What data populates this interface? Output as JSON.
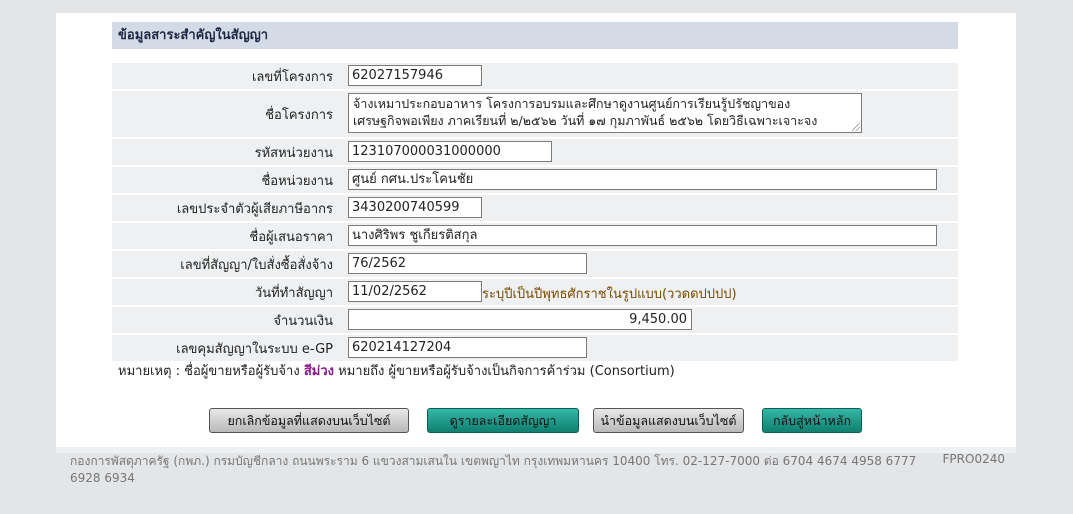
{
  "section_title": "ข้อมูลสาระสำคัญในสัญญา",
  "fields": {
    "project_no_label": "เลขที่โครงการ",
    "project_no": "62027157946",
    "project_name_label": "ชื่อโครงการ",
    "project_name_line1": "จ้างเหมาประกอบอาหาร โครงการอบรมและศึกษาดูงานศูนย์การเรียนรู้ปรัชญาของ",
    "project_name_line2": "เศรษฐกิจพอเพียง ภาคเรียนที่ ๒/๒๕๖๒ วันที่ ๑๗ กุมภาพันธ์ ๒๕๖๒ โดยวิธีเฉพาะเจาะจง",
    "agency_code_label": "รหัสหน่วยงาน",
    "agency_code": "123107000031000000",
    "agency_name_label": "ชื่อหน่วยงาน",
    "agency_name": "ศูนย์ กศน.ประโคนชัย",
    "tax_id_label": "เลขประจำตัวผู้เสียภาษีอากร",
    "tax_id": "3430200740599",
    "bidder_name_label": "ชื่อผู้เสนอราคา",
    "bidder_name": "นางศิริพร ชูเกียรติสกุล",
    "contract_no_label": "เลขที่สัญญา/ใบสั่งซื้อสั่งจ้าง",
    "contract_no": "76/2562",
    "contract_date_label": "วันที่ทำสัญญา",
    "contract_date": "11/02/2562",
    "contract_date_hint": "ระบุปีเป็นปีพุทธศักราชในรูปแบบ(ววดดปปปป)",
    "amount_label": "จำนวนเงิน",
    "amount": "9,450.00",
    "egp_control_label": "เลขคุมสัญญาในระบบ e-GP",
    "egp_control": "620214127204"
  },
  "note": {
    "prefix": "หมายเหตุ : ชื่อผู้ขายหรือผู้รับจ้าง",
    "highlight": "สีม่วง",
    "suffix": "หมายถึง ผู้ขายหรือผู้รับจ้างเป็นกิจการค้าร่วม (Consortium)",
    "highlight_color": "#8b1a8b"
  },
  "buttons": {
    "cancel_display": "ยกเลิกข้อมูลที่แสดงบนเว็บไซต์",
    "view_contract": "ดูรายละเอียดสัญญา",
    "publish": "นำข้อมูลแสดงบนเว็บไซต์",
    "home": "กลับสู่หน้าหลัก"
  },
  "footer": {
    "address": "กองการพัสดุภาครัฐ (กพภ.) กรมบัญชีกลาง ถนนพระราม 6 แขวงสามเสนใน เขตพญาไท กรุงเทพมหานคร 10400 โทร. 02-127-7000 ต่อ 6704 4674 4958 6777 6928 6934",
    "code": "FPRO0240"
  },
  "colors": {
    "header_bg": "#d4dbe6",
    "row_bg": "#eef0f2",
    "teal_button": "#1a9a88"
  }
}
